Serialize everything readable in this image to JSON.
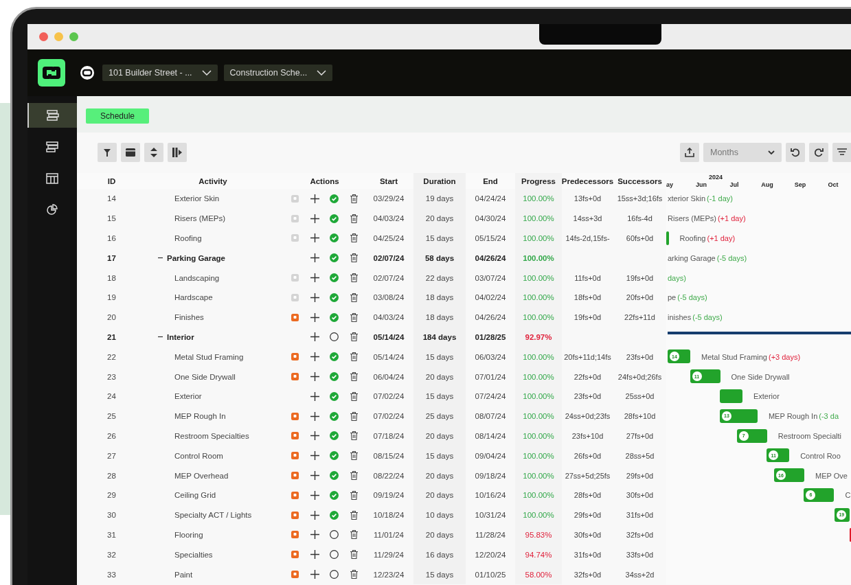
{
  "header": {
    "project": "101 Builder Street - ...",
    "schedule": "Construction Sche..."
  },
  "sidebar": {
    "items": [
      {
        "selected": true
      },
      {
        "selected": false
      },
      {
        "selected": false
      },
      {
        "selected": false
      }
    ]
  },
  "tabs": [
    {
      "label": "Schedule",
      "selected": true
    }
  ],
  "toolbar": {
    "scale": "Months"
  },
  "table": {
    "columns": [
      "ID",
      "Activity",
      "Actions",
      "Start",
      "Duration",
      "End",
      "Progress",
      "Predecessors",
      "Successors"
    ],
    "rows": [
      {
        "id": "14",
        "activity": "Exterior Skin",
        "kind": "task",
        "note_active": false,
        "done": true,
        "start": "03/29/24",
        "duration": "19 days",
        "end": "04/24/24",
        "progress": "100.00%",
        "predecessors": "13fs+0d",
        "successors": "15ss+3d;16fs",
        "bar": {
          "label": "xterior Skin",
          "delta": "(-1 day)",
          "late": false
        }
      },
      {
        "id": "15",
        "activity": "Risers (MEPs)",
        "kind": "task",
        "note_active": false,
        "done": true,
        "start": "04/03/24",
        "duration": "20 days",
        "end": "04/30/24",
        "progress": "100.00%",
        "predecessors": "14ss+3d",
        "successors": "16fs-4d",
        "bar": {
          "label": "Risers (MEPs)",
          "delta": "(+1 day)",
          "late": true
        }
      },
      {
        "id": "16",
        "activity": "Roofing",
        "kind": "task",
        "note_active": false,
        "done": true,
        "start": "04/25/24",
        "duration": "15 days",
        "end": "05/15/24",
        "progress": "100.00%",
        "predecessors": "14fs-2d,15fs-",
        "successors": "60fs+0d",
        "bar": {
          "label": "Roofing",
          "delta": "(+1 day)",
          "late": true
        }
      },
      {
        "id": "17",
        "activity": "Parking Garage",
        "kind": "group",
        "expanded": true,
        "done": true,
        "start": "02/07/24",
        "duration": "58 days",
        "end": "04/26/24",
        "progress": "100.00%",
        "bar": {
          "label": "arking Garage",
          "delta": "(-5 days)",
          "late": false
        },
        "children": [
          {
            "id": "18",
            "activity": "Landscaping",
            "kind": "task",
            "note_active": false,
            "done": true,
            "start": "02/07/24",
            "duration": "22 days",
            "end": "03/07/24",
            "progress": "100.00%",
            "predecessors": "11fs+0d",
            "successors": "19fs+0d",
            "bar": {
              "delta": "days)",
              "late": false
            }
          },
          {
            "id": "19",
            "activity": "Hardscape",
            "kind": "task",
            "note_active": false,
            "done": true,
            "start": "03/08/24",
            "duration": "18 days",
            "end": "04/02/24",
            "progress": "100.00%",
            "predecessors": "18fs+0d",
            "successors": "20fs+0d",
            "bar": {
              "label": "pe",
              "delta": "(-5 days)",
              "late": false
            }
          },
          {
            "id": "20",
            "activity": "Finishes",
            "kind": "task",
            "note_active": true,
            "done": true,
            "start": "04/03/24",
            "duration": "18 days",
            "end": "04/26/24",
            "progress": "100.00%",
            "predecessors": "19fs+0d",
            "successors": "22fs+11d",
            "bar": {
              "label": "inishes",
              "delta": "(-5 days)",
              "late": false
            }
          }
        ]
      },
      {
        "id": "21",
        "activity": "Interior",
        "kind": "group",
        "expanded": true,
        "done": false,
        "start": "05/14/24",
        "duration": "184 days",
        "end": "01/28/25",
        "progress": "92.97%",
        "children": [
          {
            "id": "22",
            "activity": "Metal Stud Framing",
            "kind": "task",
            "note_active": true,
            "done": true,
            "start": "05/14/24",
            "duration": "15 days",
            "end": "06/03/24",
            "progress": "100.00%",
            "predecessors": "20fs+11d;14fs",
            "successors": "23fs+0d",
            "bar": {
              "badge": "14",
              "label": "Metal Stud Framing",
              "delta": "(+3 days)",
              "late": true
            }
          },
          {
            "id": "23",
            "activity": "One Side Drywall",
            "kind": "task",
            "note_active": true,
            "done": true,
            "start": "06/04/24",
            "duration": "20 days",
            "end": "07/01/24",
            "progress": "100.00%",
            "predecessors": "22fs+0d",
            "successors": "24fs+0d;26fs",
            "bar": {
              "badge": "11",
              "label": "One Side Drywall"
            }
          },
          {
            "id": "24",
            "activity": "Exterior",
            "kind": "task",
            "done": true,
            "start": "07/02/24",
            "duration": "15 days",
            "end": "07/24/24",
            "progress": "100.00%",
            "predecessors": "23fs+0d",
            "successors": "25ss+0d",
            "bar": {
              "label": "Exterior"
            }
          },
          {
            "id": "25",
            "activity": "MEP Rough In",
            "kind": "task",
            "note_active": true,
            "done": true,
            "start": "07/02/24",
            "duration": "25 days",
            "end": "08/07/24",
            "progress": "100.00%",
            "predecessors": "24ss+0d;23fs",
            "successors": "28fs+10d",
            "bar": {
              "badge": "13",
              "label": "MEP Rough In",
              "delta": "(-3 da",
              "late": false
            }
          },
          {
            "id": "26",
            "activity": "Restroom Specialties",
            "kind": "task",
            "note_active": true,
            "done": true,
            "start": "07/18/24",
            "duration": "20 days",
            "end": "08/14/24",
            "progress": "100.00%",
            "predecessors": "23fs+10d",
            "successors": "27fs+0d",
            "bar": {
              "badge": "7",
              "label": "Restroom Specialti"
            }
          },
          {
            "id": "27",
            "activity": "Control Room",
            "kind": "task",
            "note_active": true,
            "done": true,
            "start": "08/15/24",
            "duration": "15 days",
            "end": "09/04/24",
            "progress": "100.00%",
            "predecessors": "26fs+0d",
            "successors": "28ss+5d",
            "bar": {
              "badge": "11",
              "label": "Control Roo"
            }
          },
          {
            "id": "28",
            "activity": "MEP Overhead",
            "kind": "task",
            "note_active": true,
            "done": true,
            "start": "08/22/24",
            "duration": "20 days",
            "end": "09/18/24",
            "progress": "100.00%",
            "predecessors": "27ss+5d;25fs",
            "successors": "29fs+0d",
            "bar": {
              "badge": "16",
              "label": "MEP Ove"
            }
          },
          {
            "id": "29",
            "activity": "Ceiling Grid",
            "kind": "task",
            "note_active": true,
            "done": true,
            "start": "09/19/24",
            "duration": "20 days",
            "end": "10/16/24",
            "progress": "100.00%",
            "predecessors": "28fs+0d",
            "successors": "30fs+0d",
            "bar": {
              "badge": "6",
              "label": "C"
            }
          },
          {
            "id": "30",
            "activity": "Specialty ACT / Lights",
            "kind": "task",
            "note_active": true,
            "done": true,
            "start": "10/18/24",
            "duration": "10 days",
            "end": "10/31/24",
            "progress": "100.00%",
            "predecessors": "29fs+0d",
            "successors": "31fs+0d",
            "bar": {
              "badge": "19"
            }
          },
          {
            "id": "31",
            "activity": "Flooring",
            "kind": "task",
            "note_active": true,
            "done": false,
            "start": "11/01/24",
            "duration": "20 days",
            "end": "11/28/24",
            "progress": "95.83%",
            "predecessors": "30fs+0d",
            "successors": "32fs+0d"
          },
          {
            "id": "32",
            "activity": "Specialties",
            "kind": "task",
            "note_active": true,
            "done": false,
            "start": "11/29/24",
            "duration": "16 days",
            "end": "12/20/24",
            "progress": "94.74%",
            "predecessors": "31fs+0d",
            "successors": "33fs+0d"
          },
          {
            "id": "33",
            "activity": "Paint",
            "kind": "task",
            "note_active": true,
            "done": false,
            "start": "12/23/24",
            "duration": "15 days",
            "end": "01/10/25",
            "progress": "58.00%",
            "predecessors": "32fs+0d",
            "successors": "34ss+2d"
          }
        ]
      }
    ]
  },
  "timeline": {
    "year": "2024",
    "months": [
      "ay",
      "Jun",
      "Jul",
      "Aug",
      "Sep",
      "Oct"
    ]
  }
}
